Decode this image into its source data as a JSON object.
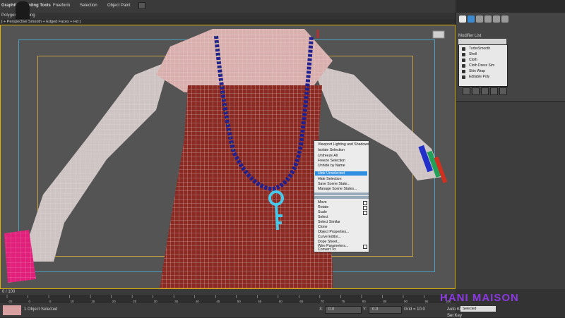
{
  "ribbon": {
    "tabs": [
      "Graphite Modeling Tools",
      "Freeform",
      "Selection",
      "Object Paint"
    ],
    "sub_label": "Polygon Modeling"
  },
  "viewport": {
    "label": "[ + Perspective  Smooth + Edged Faces + Hd ]"
  },
  "command_panel": {
    "modifier_list_label": "Modifier List",
    "stack": [
      "TurboSmooth",
      "Shell",
      "Cloth",
      "Cloth Dress Sim",
      "Skin Wrap",
      "Editable Poly"
    ]
  },
  "quad_menu": {
    "items_top": [
      "Viewport Lighting and Shadows",
      "Isolate Selection",
      "Unfreeze All",
      "Freeze Selection",
      "Unhide by Name"
    ],
    "highlighted": "Hide Unselected",
    "items_mid": [
      "Hide Selection",
      "Save Scene State...",
      "Manage Scene States..."
    ],
    "items_bottom": [
      "Move",
      "Rotate",
      "Scale",
      "Select",
      "Select Similar",
      "Clone",
      "Object Properties...",
      "Curve Editor...",
      "Dope Sheet...",
      "Wire Parameters...",
      "Convert To:"
    ]
  },
  "timeline": {
    "frame": "0 / 100",
    "ticks": [
      "-25",
      "0",
      "5",
      "10",
      "15",
      "20",
      "25",
      "30",
      "35",
      "40",
      "45",
      "50",
      "55",
      "60",
      "65",
      "70",
      "75",
      "80",
      "85",
      "90",
      "95",
      "100"
    ]
  },
  "status": {
    "selection_text": "1 Object Selected",
    "x_label": "X:",
    "x_value": "0.0",
    "y_label": "Y:",
    "y_value": "0.0",
    "grid_text": "Grid = 10.0",
    "auto_key": "Auto Key",
    "set_key": "Set Key",
    "selected_value": "Selected"
  },
  "watermark": "HANI MAISON",
  "colors": {
    "viewport_border": "#e0b200",
    "highlight": "#2f8fe0",
    "watermark": "#8a38e0"
  }
}
